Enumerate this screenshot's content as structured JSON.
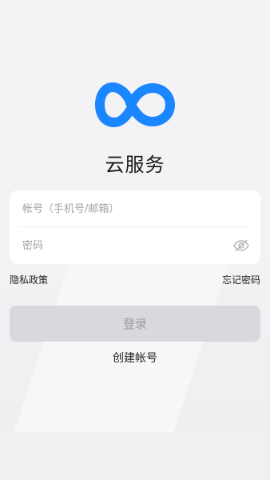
{
  "app": {
    "title": "云服务",
    "brand_color": "#1a86ff"
  },
  "form": {
    "account_placeholder": "帐号（手机号/邮箱）",
    "password_placeholder": "密码",
    "eye_icon": "eye-off-icon"
  },
  "links": {
    "privacy": "隐私政策",
    "forgot_password": "忘记密码"
  },
  "actions": {
    "login": "登录",
    "create_account": "创建帐号"
  }
}
